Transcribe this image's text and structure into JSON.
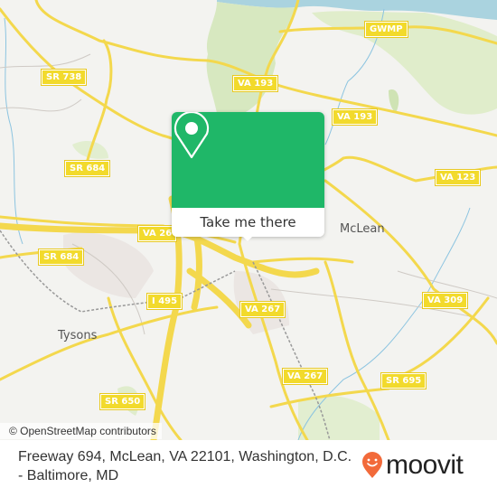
{
  "map": {
    "road_labels": [
      {
        "id": "sr738",
        "text": "SR 738"
      },
      {
        "id": "sr684a",
        "text": "SR 684"
      },
      {
        "id": "sr684b",
        "text": "SR 684"
      },
      {
        "id": "va193a",
        "text": "VA 193"
      },
      {
        "id": "va193b",
        "text": "VA 193"
      },
      {
        "id": "gwmp",
        "text": "GWMP"
      },
      {
        "id": "va123",
        "text": "VA 123"
      },
      {
        "id": "va267a",
        "text": "VA 26"
      },
      {
        "id": "i495",
        "text": "I 495"
      },
      {
        "id": "va267b",
        "text": "VA 267"
      },
      {
        "id": "va267c",
        "text": "VA 267"
      },
      {
        "id": "va309",
        "text": "VA 309"
      },
      {
        "id": "sr695",
        "text": "SR 695"
      },
      {
        "id": "sr650",
        "text": "SR 650"
      }
    ],
    "places": [
      {
        "id": "mclean",
        "text": "McLean"
      },
      {
        "id": "tysons",
        "text": "Tysons"
      }
    ],
    "attribution": "© OpenStreetMap contributors"
  },
  "popup": {
    "icon": "map-pin-icon",
    "button_label": "Take me there",
    "color": "#1fb768"
  },
  "footer": {
    "address": "Freeway 694, McLean, VA 22101, Washington, D.C. - Baltimore, MD",
    "brand": "moovit",
    "brand_color": "#f26a3a"
  }
}
